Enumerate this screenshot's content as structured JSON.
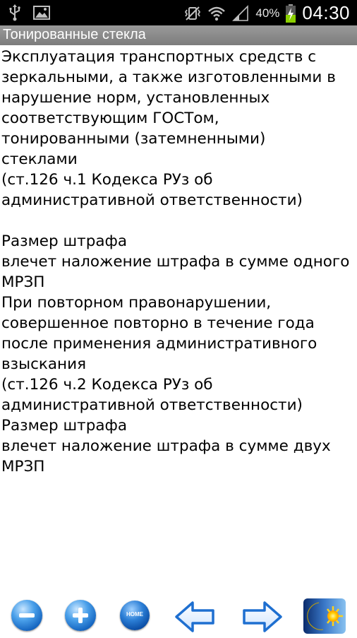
{
  "statusbar": {
    "left_icons": [
      "usb-icon",
      "image-icon"
    ],
    "right_icons": [
      "vibrate-icon",
      "wifi-icon",
      "signal-icon",
      "battery-charging-icon"
    ],
    "battery_percent": "40%",
    "time": "04:30"
  },
  "title": "Тонированные стекла",
  "content": {
    "lines_1": [
      "Эксплуатация транспортных средств с",
      "зеркальными, а также изготовленными в",
      "нарушение норм, установленных",
      "соответствующим ГОСТом,",
      "тонированными (затемненными)",
      "стеклами",
      "(ст.126 ч.1 Кодекса РУз об",
      "административной ответственности)"
    ],
    "lines_2": [
      "Размер штрафа",
      "влечет наложение штрафа в сумме одного",
      "МРЗП",
      "При повторном правонарушении,",
      "совершенное повторно в течение года",
      "после применения административного",
      "взыскания",
      "(ст.126 ч.2 Кодекса РУз об",
      "административной ответственности)",
      "Размер штрафа",
      "влечет наложение штрафа в сумме двух",
      "МРЗП"
    ]
  },
  "toolbar": {
    "buttons": [
      "zoom-out-icon",
      "zoom-in-icon",
      "home-icon",
      "back-arrow-icon",
      "forward-arrow-icon",
      "day-night-icon"
    ],
    "home_label": "HOME"
  },
  "colors": {
    "statusbar_bg": "#000000",
    "titlebar_bg": "#8a8a8a",
    "accent_blue": "#1e7bd6",
    "battery_green": "#8bd000"
  }
}
